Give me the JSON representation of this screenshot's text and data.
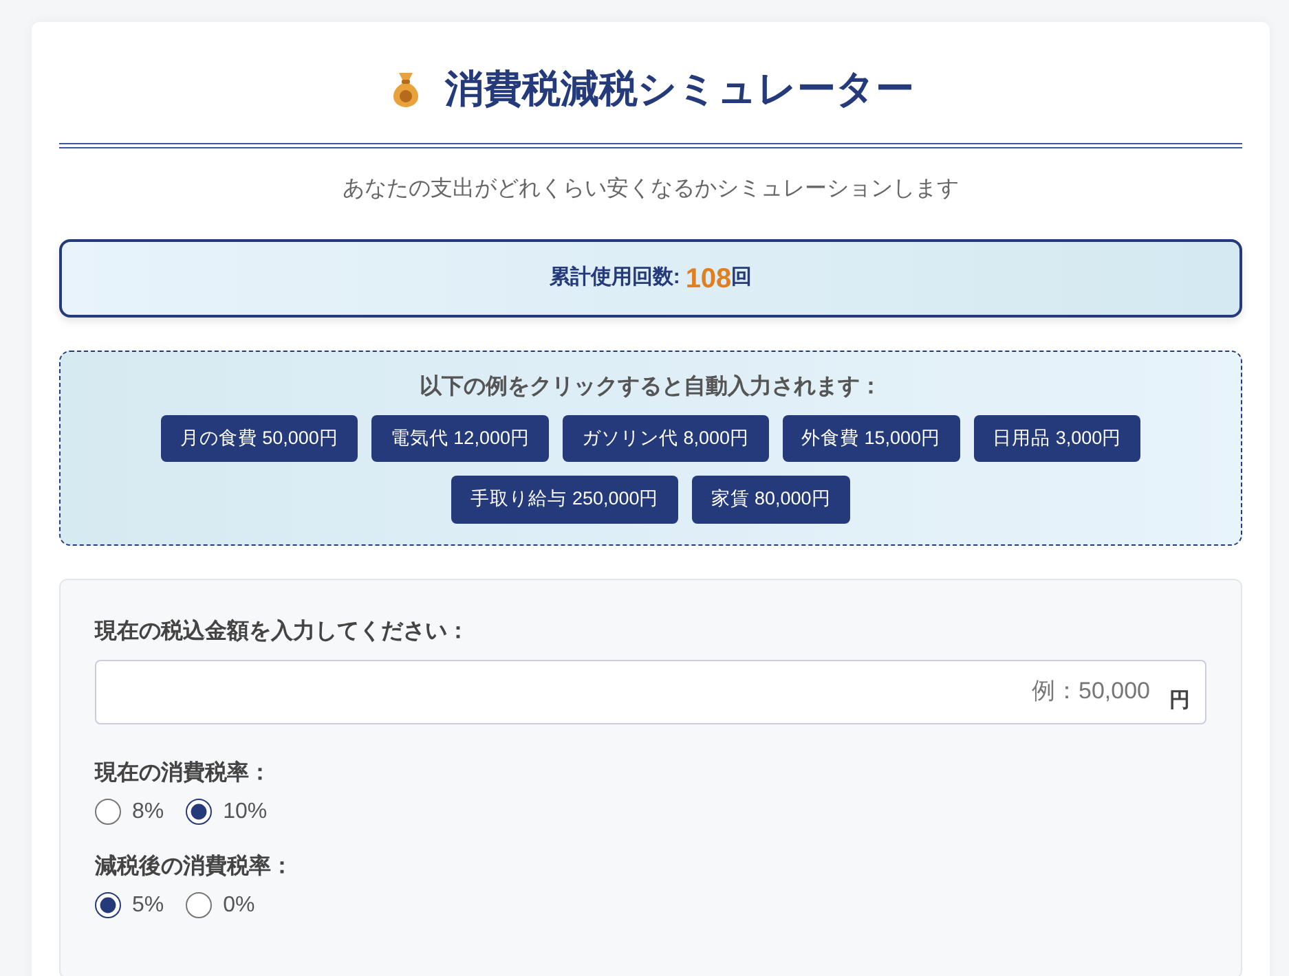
{
  "header": {
    "title": "消費税減税シミュレーター",
    "subtitle": "あなたの支出がどれくらい安くなるかシミュレーションします"
  },
  "counter": {
    "label": "累計使用回数:",
    "value": "108",
    "unit": "回"
  },
  "examples": {
    "heading": "以下の例をクリックすると自動入力されます：",
    "buttons": [
      "月の食費 50,000円",
      "電気代 12,000円",
      "ガソリン代 8,000円",
      "外食費 15,000円",
      "日用品 3,000円",
      "手取り給与 250,000円",
      "家賃 80,000円"
    ]
  },
  "form": {
    "amount_label": "現在の税込金額を入力してください：",
    "amount_placeholder": "例：50,000",
    "amount_unit": "円",
    "rate_groups": [
      {
        "label": "現在の消費税率：",
        "options": [
          {
            "label": "8%",
            "selected": false
          },
          {
            "label": "10%",
            "selected": true
          }
        ]
      },
      {
        "label": "減税後の消費税率：",
        "options": [
          {
            "label": "5%",
            "selected": true
          },
          {
            "label": "0%",
            "selected": false
          }
        ]
      }
    ]
  }
}
